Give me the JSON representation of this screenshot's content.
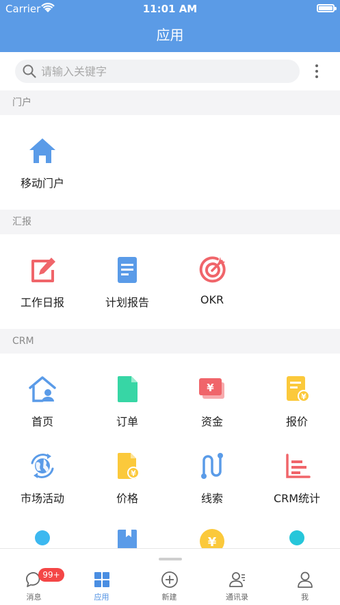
{
  "status_bar": {
    "carrier": "Carrier",
    "time": "11:01 AM"
  },
  "nav": {
    "title": "应用"
  },
  "search": {
    "placeholder": "请输入关键字"
  },
  "sections": [
    {
      "title": "门户",
      "items": [
        {
          "label": "移动门户",
          "icon": "home-icon"
        }
      ]
    },
    {
      "title": "汇报",
      "items": [
        {
          "label": "工作日报",
          "icon": "edit-icon"
        },
        {
          "label": "计划报告",
          "icon": "document-icon"
        },
        {
          "label": "OKR",
          "icon": "target-icon"
        }
      ]
    },
    {
      "title": "CRM",
      "items": [
        {
          "label": "首页",
          "icon": "customer-home-icon"
        },
        {
          "label": "订单",
          "icon": "order-icon"
        },
        {
          "label": "资金",
          "icon": "funds-icon"
        },
        {
          "label": "报价",
          "icon": "quote-icon"
        },
        {
          "label": "市场活动",
          "icon": "globe-sync-icon"
        },
        {
          "label": "价格",
          "icon": "price-icon"
        },
        {
          "label": "线索",
          "icon": "clue-path-icon"
        },
        {
          "label": "CRM统计",
          "icon": "bar-chart-icon"
        }
      ]
    }
  ],
  "tabs": [
    {
      "label": "消息",
      "icon": "message-icon",
      "badge": "99+"
    },
    {
      "label": "应用",
      "icon": "apps-grid-icon",
      "active": true
    },
    {
      "label": "新建",
      "icon": "add-circle-icon"
    },
    {
      "label": "通讯录",
      "icon": "contacts-icon"
    },
    {
      "label": "我",
      "icon": "profile-icon"
    }
  ],
  "colors": {
    "primary": "#5b9be6",
    "blue_icon": "#5a9be8",
    "red_icon": "#f0656a",
    "green_icon": "#37d6a5",
    "yellow_icon": "#fbc93b",
    "badge": "#f44646"
  }
}
